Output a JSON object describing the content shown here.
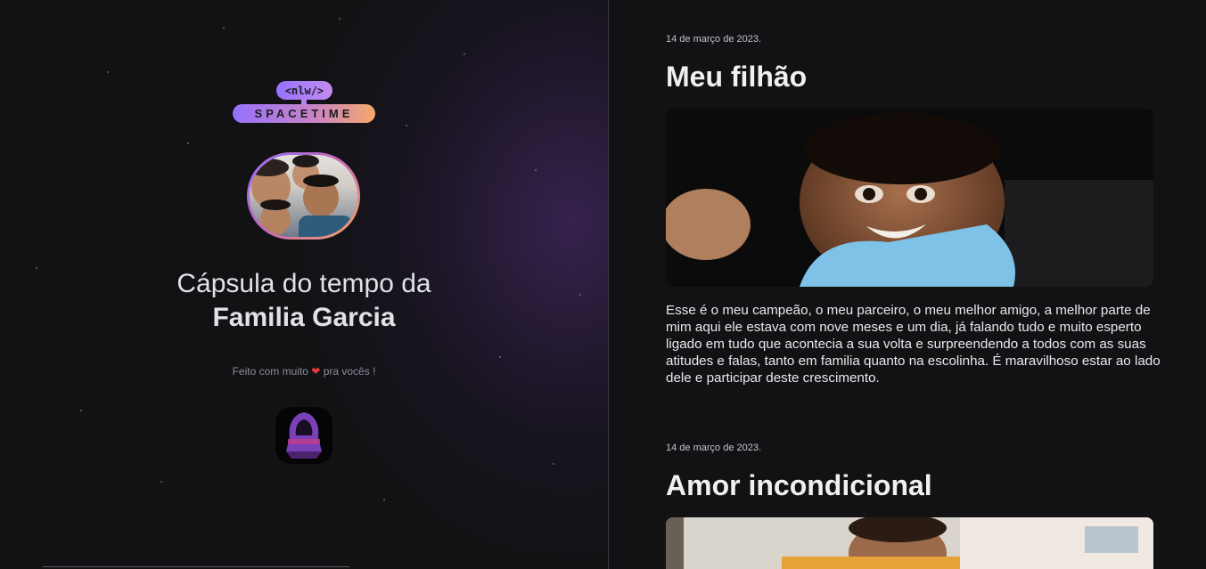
{
  "sidebar": {
    "logo": {
      "tag": "<nlw/>",
      "name": "SPACETIME"
    },
    "title_line1": "Cápsula do tempo da",
    "title_line2": "Familia Garcia",
    "made_prefix": "Feito com muito",
    "heart_icon": "heart-icon",
    "made_suffix": "pra vocês !"
  },
  "memories": [
    {
      "date": "14 de março de 2023.",
      "title": "Meu filhão",
      "text": "Esse é o meu campeão, o meu parceiro, o meu melhor amigo, a melhor parte de mim aqui ele estava com nove meses e um dia, já falando tudo e muito esperto ligado em tudo que acontecia a sua volta e surpreendendo a todos com as suas atitudes e falas, tanto em familia quanto na escolinha. É maravilhoso estar ao lado dele e participar deste crescimento."
    },
    {
      "date": "14 de março de 2023.",
      "title": "Amor incondicional"
    }
  ],
  "colors": {
    "background": "#121214",
    "purple": "#9572fc",
    "orange": "#f6a869",
    "text": "#e1e1e6"
  }
}
